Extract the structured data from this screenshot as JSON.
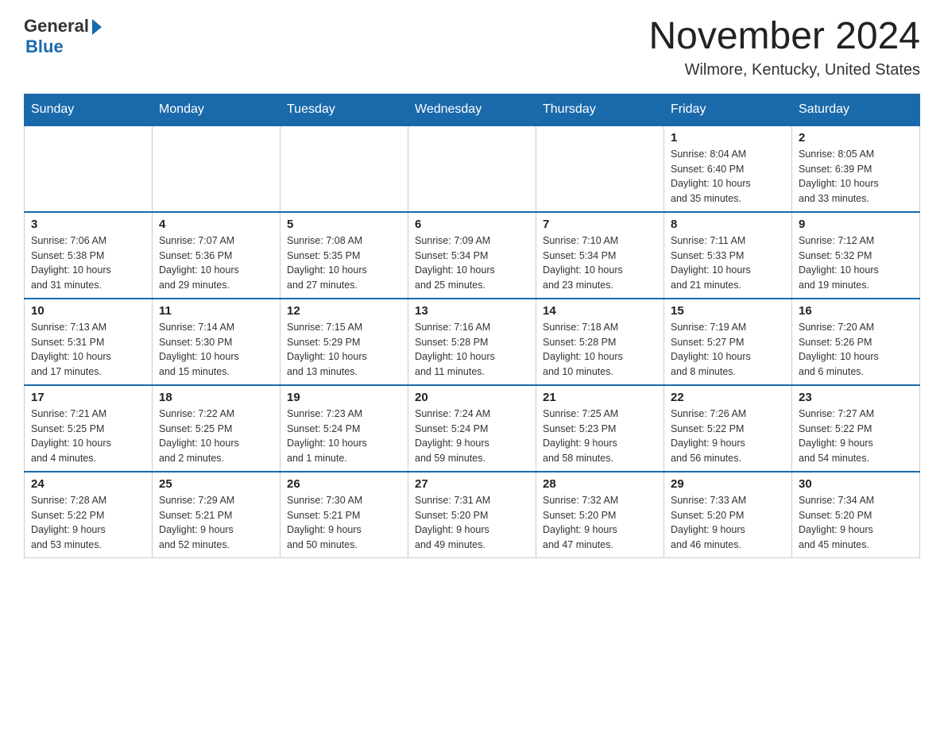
{
  "logo": {
    "general": "General",
    "blue": "Blue"
  },
  "header": {
    "title": "November 2024",
    "location": "Wilmore, Kentucky, United States"
  },
  "weekdays": [
    "Sunday",
    "Monday",
    "Tuesday",
    "Wednesday",
    "Thursday",
    "Friday",
    "Saturday"
  ],
  "weeks": [
    [
      {
        "day": "",
        "info": ""
      },
      {
        "day": "",
        "info": ""
      },
      {
        "day": "",
        "info": ""
      },
      {
        "day": "",
        "info": ""
      },
      {
        "day": "",
        "info": ""
      },
      {
        "day": "1",
        "info": "Sunrise: 8:04 AM\nSunset: 6:40 PM\nDaylight: 10 hours\nand 35 minutes."
      },
      {
        "day": "2",
        "info": "Sunrise: 8:05 AM\nSunset: 6:39 PM\nDaylight: 10 hours\nand 33 minutes."
      }
    ],
    [
      {
        "day": "3",
        "info": "Sunrise: 7:06 AM\nSunset: 5:38 PM\nDaylight: 10 hours\nand 31 minutes."
      },
      {
        "day": "4",
        "info": "Sunrise: 7:07 AM\nSunset: 5:36 PM\nDaylight: 10 hours\nand 29 minutes."
      },
      {
        "day": "5",
        "info": "Sunrise: 7:08 AM\nSunset: 5:35 PM\nDaylight: 10 hours\nand 27 minutes."
      },
      {
        "day": "6",
        "info": "Sunrise: 7:09 AM\nSunset: 5:34 PM\nDaylight: 10 hours\nand 25 minutes."
      },
      {
        "day": "7",
        "info": "Sunrise: 7:10 AM\nSunset: 5:34 PM\nDaylight: 10 hours\nand 23 minutes."
      },
      {
        "day": "8",
        "info": "Sunrise: 7:11 AM\nSunset: 5:33 PM\nDaylight: 10 hours\nand 21 minutes."
      },
      {
        "day": "9",
        "info": "Sunrise: 7:12 AM\nSunset: 5:32 PM\nDaylight: 10 hours\nand 19 minutes."
      }
    ],
    [
      {
        "day": "10",
        "info": "Sunrise: 7:13 AM\nSunset: 5:31 PM\nDaylight: 10 hours\nand 17 minutes."
      },
      {
        "day": "11",
        "info": "Sunrise: 7:14 AM\nSunset: 5:30 PM\nDaylight: 10 hours\nand 15 minutes."
      },
      {
        "day": "12",
        "info": "Sunrise: 7:15 AM\nSunset: 5:29 PM\nDaylight: 10 hours\nand 13 minutes."
      },
      {
        "day": "13",
        "info": "Sunrise: 7:16 AM\nSunset: 5:28 PM\nDaylight: 10 hours\nand 11 minutes."
      },
      {
        "day": "14",
        "info": "Sunrise: 7:18 AM\nSunset: 5:28 PM\nDaylight: 10 hours\nand 10 minutes."
      },
      {
        "day": "15",
        "info": "Sunrise: 7:19 AM\nSunset: 5:27 PM\nDaylight: 10 hours\nand 8 minutes."
      },
      {
        "day": "16",
        "info": "Sunrise: 7:20 AM\nSunset: 5:26 PM\nDaylight: 10 hours\nand 6 minutes."
      }
    ],
    [
      {
        "day": "17",
        "info": "Sunrise: 7:21 AM\nSunset: 5:25 PM\nDaylight: 10 hours\nand 4 minutes."
      },
      {
        "day": "18",
        "info": "Sunrise: 7:22 AM\nSunset: 5:25 PM\nDaylight: 10 hours\nand 2 minutes."
      },
      {
        "day": "19",
        "info": "Sunrise: 7:23 AM\nSunset: 5:24 PM\nDaylight: 10 hours\nand 1 minute."
      },
      {
        "day": "20",
        "info": "Sunrise: 7:24 AM\nSunset: 5:24 PM\nDaylight: 9 hours\nand 59 minutes."
      },
      {
        "day": "21",
        "info": "Sunrise: 7:25 AM\nSunset: 5:23 PM\nDaylight: 9 hours\nand 58 minutes."
      },
      {
        "day": "22",
        "info": "Sunrise: 7:26 AM\nSunset: 5:22 PM\nDaylight: 9 hours\nand 56 minutes."
      },
      {
        "day": "23",
        "info": "Sunrise: 7:27 AM\nSunset: 5:22 PM\nDaylight: 9 hours\nand 54 minutes."
      }
    ],
    [
      {
        "day": "24",
        "info": "Sunrise: 7:28 AM\nSunset: 5:22 PM\nDaylight: 9 hours\nand 53 minutes."
      },
      {
        "day": "25",
        "info": "Sunrise: 7:29 AM\nSunset: 5:21 PM\nDaylight: 9 hours\nand 52 minutes."
      },
      {
        "day": "26",
        "info": "Sunrise: 7:30 AM\nSunset: 5:21 PM\nDaylight: 9 hours\nand 50 minutes."
      },
      {
        "day": "27",
        "info": "Sunrise: 7:31 AM\nSunset: 5:20 PM\nDaylight: 9 hours\nand 49 minutes."
      },
      {
        "day": "28",
        "info": "Sunrise: 7:32 AM\nSunset: 5:20 PM\nDaylight: 9 hours\nand 47 minutes."
      },
      {
        "day": "29",
        "info": "Sunrise: 7:33 AM\nSunset: 5:20 PM\nDaylight: 9 hours\nand 46 minutes."
      },
      {
        "day": "30",
        "info": "Sunrise: 7:34 AM\nSunset: 5:20 PM\nDaylight: 9 hours\nand 45 minutes."
      }
    ]
  ]
}
